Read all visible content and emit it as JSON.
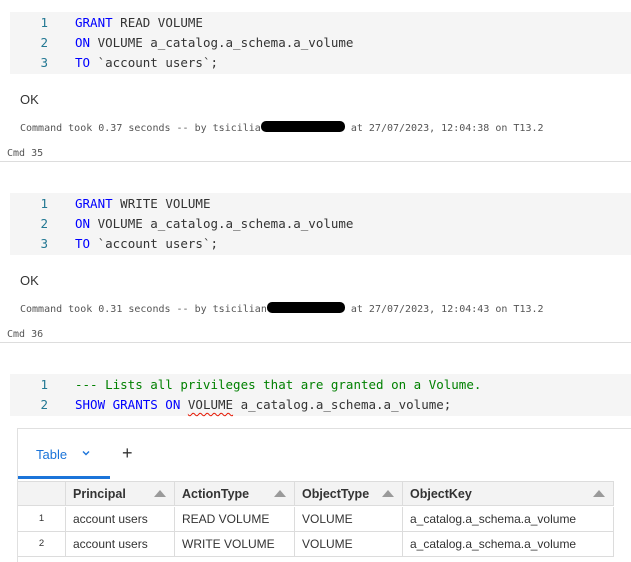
{
  "cells": [
    {
      "lines": [
        {
          "n": "1",
          "parts": [
            {
              "t": "GRANT",
              "c": "kw"
            },
            {
              "t": " READ VOLUME",
              "c": ""
            }
          ]
        },
        {
          "n": "2",
          "parts": [
            {
              "t": "ON",
              "c": "kw"
            },
            {
              "t": " VOLUME a_catalog.a_schema.a_volume",
              "c": ""
            }
          ]
        },
        {
          "n": "3",
          "parts": [
            {
              "t": "TO",
              "c": "kw"
            },
            {
              "t": " `account users`;",
              "c": ""
            }
          ]
        }
      ],
      "result": "OK",
      "meta_prefix": "Command took 0.37 seconds -- by tsicilia",
      "meta_suffix": " at 27/07/2023, 12:04:38 on T13.2"
    },
    {
      "label": "Cmd 35",
      "lines": [
        {
          "n": "1",
          "parts": [
            {
              "t": "GRANT",
              "c": "kw"
            },
            {
              "t": " WRITE VOLUME",
              "c": ""
            }
          ]
        },
        {
          "n": "2",
          "parts": [
            {
              "t": "ON",
              "c": "kw"
            },
            {
              "t": " VOLUME a_catalog.a_schema.a_volume",
              "c": ""
            }
          ]
        },
        {
          "n": "3",
          "parts": [
            {
              "t": "TO",
              "c": "kw"
            },
            {
              "t": " `account users`;",
              "c": ""
            }
          ]
        }
      ],
      "result": "OK",
      "meta_prefix": "Command took 0.31 seconds -- by tsicilian",
      "meta_suffix": " at 27/07/2023, 12:04:43 on T13.2"
    },
    {
      "label": "Cmd 36",
      "lines": [
        {
          "n": "1",
          "parts": [
            {
              "t": "--- Lists all privileges that are granted on a Volume.",
              "c": "comment"
            }
          ]
        },
        {
          "n": "2",
          "parts": [
            {
              "t": "SHOW GRANTS ON",
              "c": "kw"
            },
            {
              "t": " ",
              "c": ""
            },
            {
              "t": "VOLUME",
              "c": "squiggle"
            },
            {
              "t": " a_catalog.a_schema.a_volume;",
              "c": ""
            }
          ]
        }
      ]
    }
  ],
  "result_panel": {
    "tab_label": "Table",
    "add_icon": "+",
    "columns": [
      "Principal",
      "ActionType",
      "ObjectType",
      "ObjectKey"
    ],
    "rows": [
      {
        "index": "1",
        "values": [
          "account users",
          "READ VOLUME",
          "VOLUME",
          "a_catalog.a_schema.a_volume"
        ]
      },
      {
        "index": "2",
        "values": [
          "account users",
          "WRITE VOLUME",
          "VOLUME",
          "a_catalog.a_schema.a_volume"
        ]
      }
    ]
  },
  "colors": {
    "keyword": "#0000ff",
    "comment": "#008000",
    "line_number": "#237893",
    "accent": "#1b74d9"
  },
  "icons": {
    "tab_dropdown": "chevron-down-icon",
    "add": "plus-icon",
    "sort": "sort-arrow-icon",
    "redaction": "redacted-username"
  }
}
